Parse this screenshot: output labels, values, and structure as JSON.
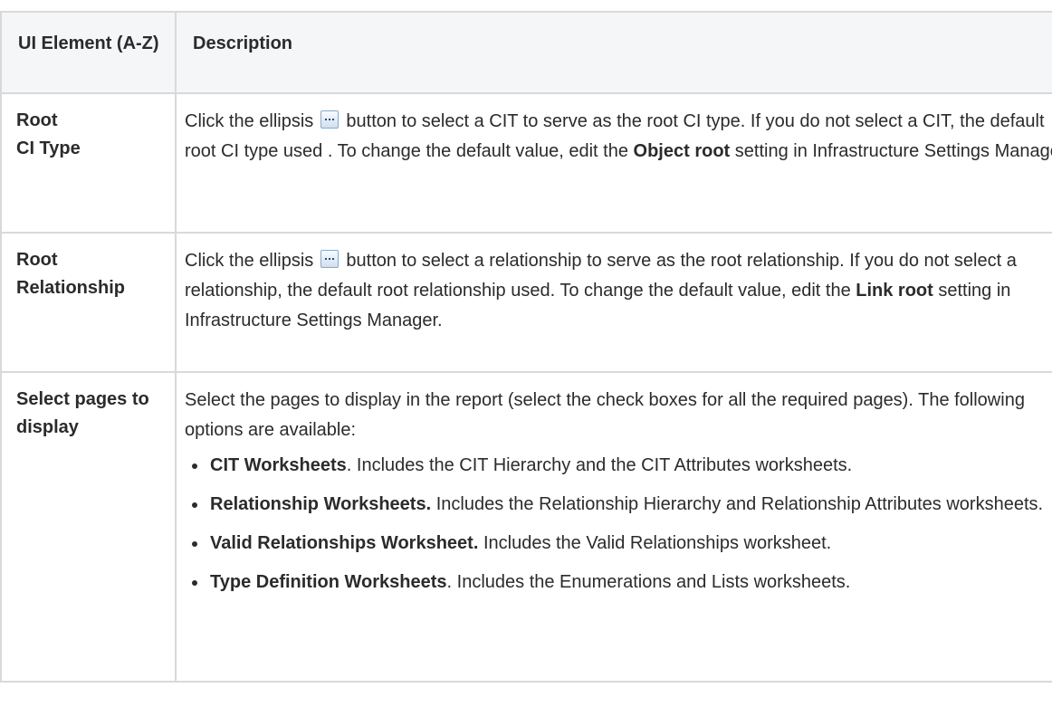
{
  "table": {
    "headers": {
      "col1": "UI Element (A-Z)",
      "col2": "Description"
    },
    "rows": [
      {
        "term_line1": "Root",
        "term_line2": "CI Type",
        "desc_part1": "Click the ellipsis",
        "desc_part2": "button to select a CIT to serve as the root CI type. If you do not select a CIT, the default root CI type used . To change the default value, edit the",
        "desc_bold": "Object root",
        "desc_part3": "setting in Infrastructure Settings Manager."
      },
      {
        "term_line1": "Root",
        "term_line2": "Relationship",
        "desc_part1": "Click the ellipsis",
        "desc_part2": "button to select a relationship to serve as the root relationship. If you do not select a relationship, the default root relationship used. To change the default value, edit the",
        "desc_bold": "Link root",
        "desc_part3": "setting in Infrastructure Settings Manager."
      },
      {
        "term": "Select pages to display",
        "intro": "Select the pages to display in the report (select the check boxes for all the required pages). The following options are available:",
        "options": [
          {
            "bold": "CIT Worksheets",
            "text": ". Includes the CIT Hierarchy and the CIT Attributes worksheets."
          },
          {
            "bold": "Relationship Worksheets.",
            "text": " Includes the Relationship Hierarchy and Relationship Attributes worksheets."
          },
          {
            "bold": "Valid Relationships Worksheet.",
            "text": " Includes the Valid Relationships worksheet."
          },
          {
            "bold": "Type Definition Worksheets",
            "text": ". Includes the Enumerations and Lists worksheets."
          }
        ]
      }
    ]
  },
  "icons": {
    "ellipsis_button": "ellipsis-button-icon"
  }
}
